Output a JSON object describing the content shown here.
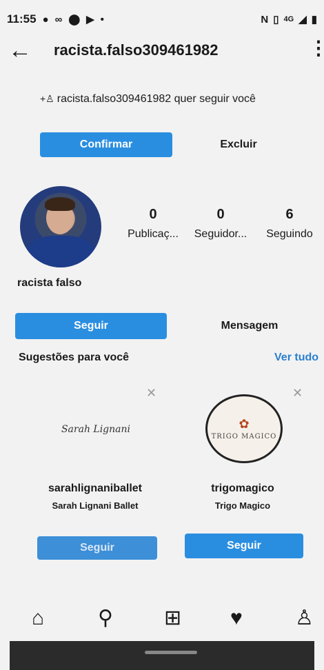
{
  "status_bar": {
    "time": "11:55",
    "left_icons": [
      "notification-icon",
      "voicemail-icon",
      "location-icon",
      "youtube-icon",
      "dot-icon"
    ],
    "right_text": "4G",
    "right_icons": [
      "nfc-icon",
      "vibrate-icon",
      "signal-icon",
      "battery-icon"
    ]
  },
  "header": {
    "title": "racista.falso309461982"
  },
  "follow_request": {
    "text": "racista.falso309461982 quer seguir você",
    "confirm_label": "Confirmar",
    "delete_label": "Excluir"
  },
  "profile": {
    "name": "racista falso",
    "stats": [
      {
        "value": "0",
        "label": "Publicaç..."
      },
      {
        "value": "0",
        "label": "Seguidor..."
      },
      {
        "value": "6",
        "label": "Seguindo"
      }
    ],
    "follow_label": "Seguir",
    "message_label": "Mensagem"
  },
  "suggestions": {
    "title": "Sugestões para você",
    "see_all": "Ver tudo",
    "cards": [
      {
        "username": "sarahlignaniballet",
        "full_name": "Sarah Lignani Ballet",
        "logo_text": "Sarah Lignani",
        "follow_label": "Seguir"
      },
      {
        "username": "trigomagico",
        "full_name": "Trigo Magico",
        "logo_text": "TRIGO MAGICO",
        "follow_label": "Seguir"
      }
    ]
  },
  "colors": {
    "accent": "#2a8ee0",
    "link": "#2a7fd0",
    "background": "#f2f2f2"
  }
}
